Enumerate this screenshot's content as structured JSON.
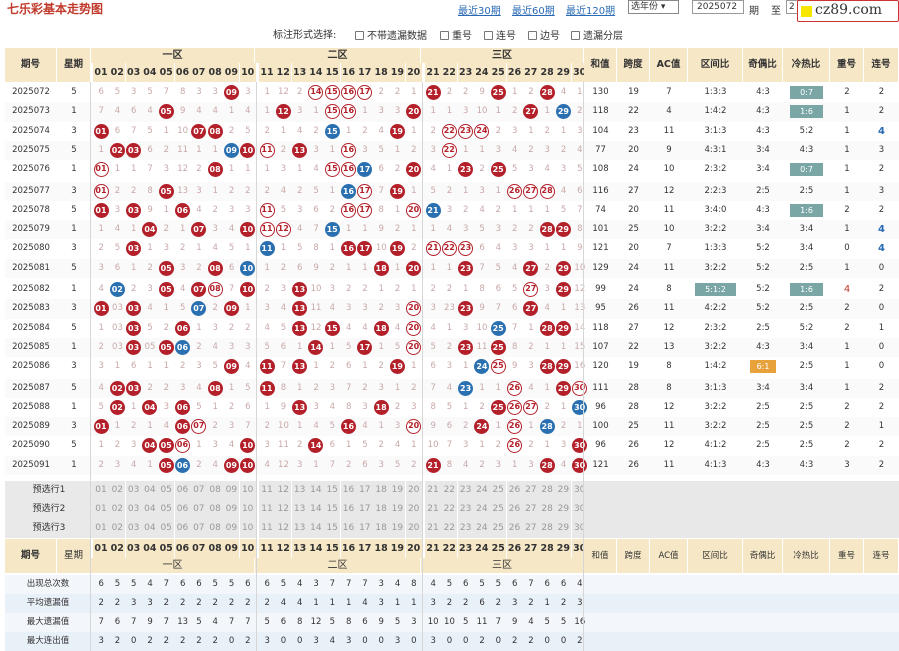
{
  "header": {
    "title": "七乐彩基本走势图",
    "links": [
      "最近30期",
      "最近60期",
      "最近120期"
    ],
    "year_select": "选年份",
    "from_issue": "2025072",
    "label_qi": "期",
    "label_to": "至",
    "to_issue": "2",
    "logo_text": "cz89.com"
  },
  "options": {
    "label": "标注形式选择:",
    "items": [
      "不带遗漏数据",
      "重号",
      "连号",
      "边号",
      "遗漏分层"
    ]
  },
  "columns": {
    "issue": "期号",
    "week": "星期",
    "zones": [
      "一区",
      "二区",
      "三区"
    ],
    "sum": "和值",
    "span": "跨度",
    "ac": "AC值",
    "zone_ratio": "区间比",
    "odd_even": "奇偶比",
    "hot_cold": "冷热比",
    "repeat": "重号",
    "consecutive": "连号"
  },
  "numbers": [
    "01",
    "02",
    "03",
    "04",
    "05",
    "06",
    "07",
    "08",
    "09",
    "10",
    "11",
    "12",
    "13",
    "14",
    "15",
    "16",
    "17",
    "18",
    "19",
    "20",
    "21",
    "22",
    "23",
    "24",
    "25",
    "26",
    "27",
    "28",
    "29",
    "30"
  ],
  "rows": [
    {
      "issue": "2025072",
      "week": "5",
      "cells": [
        "6",
        "5",
        "3",
        "5",
        "7",
        "8",
        "3",
        "3",
        "09b",
        "3",
        "1",
        "12",
        "2",
        "14",
        "15",
        "16",
        "17",
        "2",
        "2",
        "1",
        "21",
        "2",
        "2",
        "9",
        "25",
        "1",
        "2",
        "28",
        "4",
        "1"
      ],
      "marks": {
        "9": "red",
        "14": "redo",
        "15": "redo",
        "16": "redo",
        "17": "redo",
        "21": "red",
        "25": "red",
        "28": "red"
      },
      "sum": "130",
      "span": "19",
      "ac": "7",
      "zr": "1:3:3",
      "oe": "4:3",
      "hc": "0:7",
      "hcStyle": "teal",
      "rep": "2",
      "con": "2"
    },
    {
      "issue": "2025073",
      "week": "1",
      "cells": [
        "7",
        "4",
        "6",
        "4",
        "05",
        "9",
        "4",
        "4",
        "1",
        "4",
        "1",
        "12",
        "3",
        "1",
        "15",
        "16",
        "1",
        "3",
        "3",
        "20",
        "1",
        "1",
        "3",
        "10",
        "1",
        "2",
        "27",
        "1",
        "29",
        "2"
      ],
      "marks": {
        "5": "red",
        "12": "red",
        "15": "redo",
        "16": "redo",
        "20": "red",
        "27": "red",
        "29": "blue"
      },
      "sum": "118",
      "span": "22",
      "ac": "4",
      "zr": "1:4:2",
      "oe": "4:3",
      "hc": "1:6",
      "hcStyle": "teal",
      "rep": "1",
      "con": "2"
    },
    {
      "issue": "2025074",
      "week": "3",
      "cells": [
        "01",
        "6",
        "7",
        "5",
        "1",
        "10",
        "07",
        "08",
        "2",
        "5",
        "2",
        "1",
        "4",
        "2",
        "15",
        "1",
        "2",
        "4",
        "19",
        "1",
        "2",
        "22",
        "23",
        "24",
        "2",
        "3",
        "1",
        "2",
        "1",
        "3"
      ],
      "marks": {
        "1": "red",
        "7": "red",
        "8": "red",
        "15": "blue",
        "19": "red",
        "22": "redo",
        "23": "redo",
        "24": "redo"
      },
      "sum": "104",
      "span": "23",
      "ac": "11",
      "zr": "3:1:3",
      "oe": "4:3",
      "hc": "5:2",
      "rep": "1",
      "con": "4"
    },
    {
      "issue": "2025075",
      "week": "5",
      "cells": [
        "1",
        "02",
        "03",
        "6",
        "2",
        "11",
        "1",
        "1",
        "09",
        "10",
        "11",
        "2",
        "13",
        "3",
        "1",
        "16",
        "3",
        "5",
        "1",
        "2",
        "3",
        "22",
        "1",
        "1",
        "3",
        "4",
        "2",
        "3",
        "2",
        "4"
      ],
      "marks": {
        "2": "red",
        "3": "red",
        "9": "blue",
        "10": "red",
        "11": "redo",
        "13": "red",
        "16": "redo",
        "22": "redo"
      },
      "sum": "77",
      "span": "20",
      "ac": "9",
      "zr": "4:3:1",
      "oe": "3:4",
      "hc": "4:3",
      "rep": "1",
      "con": "3"
    },
    {
      "issue": "2025076",
      "week": "1",
      "cells": [
        "01",
        "1",
        "1",
        "7",
        "3",
        "12",
        "2",
        "08",
        "1",
        "1",
        "1",
        "3",
        "1",
        "4",
        "15",
        "16",
        "17",
        "6",
        "2",
        "20",
        "4",
        "1",
        "23",
        "2",
        "25",
        "5",
        "3",
        "4",
        "3",
        "5"
      ],
      "marks": {
        "1": "redo",
        "8": "red",
        "15": "redo",
        "16": "redo",
        "17": "blue",
        "20": "red",
        "23": "red",
        "25": "red"
      },
      "sum": "108",
      "span": "24",
      "ac": "10",
      "zr": "2:3:2",
      "oe": "3:4",
      "hc": "0:7",
      "hcStyle": "teal",
      "rep": "1",
      "con": "2"
    },
    {
      "issue": "2025077",
      "week": "3",
      "cells": [
        "01",
        "2",
        "2",
        "8",
        "05",
        "13",
        "3",
        "1",
        "2",
        "2",
        "2",
        "4",
        "2",
        "5",
        "1",
        "16",
        "17",
        "7",
        "18",
        "1",
        "5",
        "2",
        "1",
        "3",
        "1",
        "26",
        "27",
        "28",
        "4",
        "6"
      ],
      "marks": {
        "1": "redo",
        "5": "red",
        "16": "blue",
        "17": "redo",
        "19": "red",
        "26": "redo",
        "27": "redo",
        "28": "redo"
      },
      "sum": "116",
      "span": "27",
      "ac": "12",
      "zr": "2:2:3",
      "oe": "2:5",
      "hc": "2:5",
      "rep": "1",
      "con": "3"
    },
    {
      "issue": "2025078",
      "week": "5",
      "cells": [
        "01",
        "3",
        "03",
        "9",
        "1",
        "06",
        "4",
        "2",
        "3",
        "3",
        "11",
        "5",
        "3",
        "6",
        "2",
        "16",
        "17",
        "8",
        "1",
        "20",
        "21",
        "3",
        "2",
        "4",
        "2",
        "1",
        "1",
        "1",
        "5",
        "7"
      ],
      "marks": {
        "1": "red",
        "3": "red",
        "6": "red",
        "11": "redo",
        "16": "redo",
        "17": "redo",
        "20": "redo",
        "21": "blue"
      },
      "sum": "74",
      "span": "20",
      "ac": "11",
      "zr": "3:4:0",
      "oe": "4:3",
      "hc": "1:6",
      "hcStyle": "teal",
      "rep": "2",
      "con": "2"
    },
    {
      "issue": "2025079",
      "week": "1",
      "cells": [
        "1",
        "4",
        "1",
        "04",
        "2",
        "1",
        "07",
        "3",
        "4",
        "10",
        "11",
        "12",
        "4",
        "7",
        "15",
        "1",
        "1",
        "9",
        "2",
        "1",
        "1",
        "4",
        "3",
        "5",
        "3",
        "2",
        "2",
        "28",
        "29",
        "8"
      ],
      "marks": {
        "4": "red",
        "7": "red",
        "10": "red",
        "11": "redo",
        "12": "redo",
        "15": "blue",
        "28": "red",
        "29": "red"
      },
      "sum": "101",
      "span": "25",
      "ac": "10",
      "zr": "3:2:2",
      "oe": "3:4",
      "hc": "3:4",
      "rep": "1",
      "con": "4"
    },
    {
      "issue": "2025080",
      "week": "3",
      "cells": [
        "2",
        "5",
        "03",
        "1",
        "3",
        "2",
        "1",
        "4",
        "5",
        "1",
        "11",
        "1",
        "5",
        "8",
        "1",
        "16",
        "17",
        "10",
        "19",
        "2",
        "21",
        "22",
        "23",
        "6",
        "4",
        "3",
        "3",
        "1",
        "1",
        "9"
      ],
      "marks": {
        "3": "red",
        "11": "blue",
        "16": "red",
        "17": "red",
        "19": "red",
        "21": "redo",
        "22": "redo",
        "23": "redo"
      },
      "sum": "121",
      "span": "20",
      "ac": "7",
      "zr": "1:3:3",
      "oe": "5:2",
      "hc": "3:4",
      "rep": "0",
      "con": "4"
    },
    {
      "issue": "2025081",
      "week": "5",
      "cells": [
        "3",
        "6",
        "1",
        "2",
        "05",
        "3",
        "2",
        "06",
        "6",
        "10",
        "1",
        "2",
        "6",
        "9",
        "2",
        "1",
        "1",
        "18",
        "1",
        "20",
        "1",
        "1",
        "23",
        "7",
        "5",
        "4",
        "27",
        "2",
        "29",
        "10"
      ],
      "marks": {
        "5": "red",
        "8": "red",
        "10": "blue",
        "18": "red",
        "20": "red",
        "23": "red",
        "27": "red",
        "29": "red"
      },
      "sum": "129",
      "span": "24",
      "ac": "11",
      "zr": "3:2:2",
      "oe": "5:2",
      "hc": "2:5",
      "rep": "1",
      "con": "0"
    },
    {
      "issue": "2025082",
      "week": "1",
      "cells": [
        "4",
        "02",
        "2",
        "3",
        "05",
        "4",
        "07",
        "08",
        "7",
        "10",
        "2",
        "3",
        "13",
        "10",
        "3",
        "2",
        "2",
        "1",
        "2",
        "1",
        "2",
        "2",
        "1",
        "8",
        "6",
        "5",
        "27",
        "3",
        "29",
        "12"
      ],
      "marks": {
        "2": "blue",
        "5": "red",
        "7": "red",
        "8": "redo",
        "10": "red",
        "13": "red",
        "27": "redo",
        "29": "red"
      },
      "sum": "99",
      "span": "24",
      "ac": "8",
      "zr": "5:1:2",
      "zrStyle": "teal",
      "oe": "5:2",
      "hc": "1:6",
      "hcStyle": "teal",
      "rep": "4",
      "con": "2"
    },
    {
      "issue": "2025083",
      "week": "3",
      "cells": [
        "01",
        "03",
        "3",
        "4",
        "1",
        "5",
        "07",
        "2",
        "09",
        "1",
        "3",
        "4",
        "13",
        "11",
        "4",
        "3",
        "3",
        "2",
        "3",
        "20",
        "3",
        "23",
        "2",
        "9",
        "7",
        "6",
        "27",
        "4",
        "1",
        "13"
      ],
      "marks": {
        "1": "red",
        "3": "red",
        "7": "blue",
        "9": "red",
        "13": "red",
        "20": "redo",
        "23": "red",
        "27": "red"
      },
      "sum": "95",
      "span": "26",
      "ac": "11",
      "zr": "4:2:2",
      "oe": "5:2",
      "hc": "2:5",
      "rep": "2",
      "con": "0"
    },
    {
      "issue": "2025084",
      "week": "5",
      "cells": [
        "1",
        "03",
        "4",
        "5",
        "2",
        "06",
        "1",
        "3",
        "2",
        "2",
        "4",
        "5",
        "13",
        "12",
        "15",
        "4",
        "4",
        "18",
        "4",
        "20",
        "4",
        "1",
        "3",
        "10",
        "25",
        "7",
        "1",
        "28",
        "29",
        "14"
      ],
      "marks": {
        "3": "red",
        "6": "red",
        "13": "red",
        "15": "red",
        "18": "red",
        "20": "redo",
        "25": "blue",
        "28": "red",
        "29": "red"
      },
      "sum": "118",
      "span": "27",
      "ac": "12",
      "zr": "2:3:2",
      "oe": "2:5",
      "hc": "5:2",
      "rep": "2",
      "con": "1"
    },
    {
      "issue": "2025085",
      "week": "1",
      "cells": [
        "2",
        "03",
        "5",
        "05",
        "06",
        "1",
        "2",
        "4",
        "3",
        "3",
        "5",
        "6",
        "1",
        "14",
        "1",
        "5",
        "17",
        "1",
        "5",
        "20",
        "5",
        "2",
        "23",
        "11",
        "25",
        "8",
        "2",
        "1",
        "1",
        "15"
      ],
      "marks": {
        "3": "red",
        "5": "red",
        "6": "blue",
        "14": "red",
        "17": "red",
        "20": "redo",
        "23": "red",
        "25": "red"
      },
      "sum": "107",
      "span": "22",
      "ac": "13",
      "zr": "3:2:2",
      "oe": "4:3",
      "hc": "3:4",
      "rep": "1",
      "con": "0"
    },
    {
      "issue": "2025086",
      "week": "3",
      "cells": [
        "3",
        "1",
        "6",
        "1",
        "1",
        "2",
        "3",
        "5",
        "09",
        "4",
        "11",
        "7",
        "13",
        "1",
        "2",
        "6",
        "1",
        "2",
        "19",
        "1",
        "6",
        "3",
        "1",
        "24",
        "25",
        "9",
        "3",
        "28",
        "2",
        "16"
      ],
      "marks": {
        "9": "red",
        "11": "red",
        "13": "red",
        "19": "red",
        "24": "blue",
        "25": "redo",
        "28": "red",
        "29": "red"
      },
      "sum": "120",
      "span": "19",
      "ac": "8",
      "zr": "1:4:2",
      "oe": "6:1",
      "oeStyle": "orange",
      "hc": "2:5",
      "rep": "1",
      "con": "0"
    },
    {
      "issue": "2025087",
      "week": "5",
      "cells": [
        "4",
        "02",
        "03",
        "2",
        "2",
        "3",
        "4",
        "08",
        "1",
        "5",
        "11",
        "8",
        "1",
        "2",
        "3",
        "7",
        "2",
        "3",
        "1",
        "2",
        "7",
        "4",
        "23",
        "1",
        "1",
        "26",
        "4",
        "1",
        "29",
        "30"
      ],
      "marks": {
        "2": "red",
        "3": "red",
        "8": "red",
        "11": "red",
        "23": "blue",
        "26": "redo",
        "29": "red",
        "30": "redo"
      },
      "sum": "111",
      "span": "28",
      "ac": "8",
      "zr": "3:1:3",
      "oe": "3:4",
      "hc": "3:4",
      "rep": "1",
      "con": "2"
    },
    {
      "issue": "2025088",
      "week": "1",
      "cells": [
        "5",
        "02",
        "1",
        "04",
        "3",
        "06",
        "5",
        "1",
        "2",
        "6",
        "1",
        "9",
        "13",
        "3",
        "4",
        "8",
        "3",
        "18",
        "2",
        "3",
        "8",
        "5",
        "1",
        "2",
        "25",
        "26",
        "27",
        "2",
        "1",
        "30"
      ],
      "marks": {
        "2": "red",
        "4": "red",
        "6": "red",
        "13": "red",
        "18": "red",
        "25": "red",
        "26": "redo",
        "27": "redo",
        "30": "blue"
      },
      "sum": "96",
      "span": "28",
      "ac": "12",
      "zr": "3:2:2",
      "oe": "2:5",
      "hc": "2:5",
      "rep": "2",
      "con": "2"
    },
    {
      "issue": "2025089",
      "week": "3",
      "cells": [
        "01",
        "1",
        "2",
        "1",
        "4",
        "06",
        "07",
        "2",
        "3",
        "7",
        "2",
        "10",
        "1",
        "4",
        "5",
        "16",
        "4",
        "1",
        "3",
        "20",
        "9",
        "6",
        "2",
        "24",
        "1",
        "26",
        "1",
        "28",
        "2",
        "1"
      ],
      "marks": {
        "1": "red",
        "6": "red",
        "7": "redo",
        "16": "red",
        "20": "redo",
        "24": "red",
        "26": "redo",
        "28": "blue"
      },
      "sum": "100",
      "span": "25",
      "ac": "11",
      "zr": "3:2:2",
      "oe": "2:5",
      "hc": "2:5",
      "rep": "2",
      "con": "1"
    },
    {
      "issue": "2025090",
      "week": "5",
      "cells": [
        "1",
        "2",
        "3",
        "04",
        "05",
        "06",
        "1",
        "3",
        "4",
        "10",
        "3",
        "11",
        "2",
        "14",
        "6",
        "1",
        "5",
        "2",
        "4",
        "1",
        "10",
        "7",
        "3",
        "1",
        "2",
        "26",
        "2",
        "1",
        "3",
        "30"
      ],
      "marks": {
        "4": "red",
        "5": "red",
        "6": "redo",
        "10": "red",
        "14": "red",
        "26": "redo",
        "30": "red"
      },
      "sum": "96",
      "span": "26",
      "ac": "12",
      "zr": "4:1:2",
      "oe": "2:5",
      "hc": "2:5",
      "rep": "2",
      "con": "2"
    },
    {
      "issue": "2025091",
      "week": "1",
      "cells": [
        "2",
        "3",
        "4",
        "1",
        "05",
        "06",
        "2",
        "4",
        "09",
        "10",
        "4",
        "12",
        "3",
        "1",
        "7",
        "2",
        "6",
        "3",
        "5",
        "2",
        "21",
        "8",
        "4",
        "2",
        "3",
        "1",
        "3",
        "28",
        "4",
        "30"
      ],
      "marks": {
        "5": "red",
        "6": "blue",
        "9": "red",
        "10": "red",
        "21": "red",
        "28": "red",
        "30": "red"
      },
      "sum": "121",
      "span": "26",
      "ac": "11",
      "zr": "4:1:3",
      "oe": "4:3",
      "hc": "4:3",
      "rep": "3",
      "con": "2"
    }
  ],
  "predict_rows": [
    "预选行1",
    "预选行2",
    "预选行3"
  ],
  "stats": [
    {
      "label": "出现总次数",
      "values": [
        "6",
        "5",
        "5",
        "4",
        "7",
        "6",
        "6",
        "5",
        "5",
        "6",
        "6",
        "5",
        "4",
        "3",
        "7",
        "7",
        "7",
        "3",
        "4",
        "8",
        "4",
        "5",
        "6",
        "5",
        "5",
        "6",
        "7",
        "6",
        "6",
        "4"
      ]
    },
    {
      "label": "平均遗漏值",
      "values": [
        "2",
        "2",
        "3",
        "3",
        "2",
        "2",
        "2",
        "2",
        "2",
        "2",
        "2",
        "4",
        "4",
        "1",
        "1",
        "1",
        "4",
        "3",
        "1",
        "1",
        "3",
        "2",
        "2",
        "6",
        "2",
        "3",
        "2",
        "1",
        "2",
        "3"
      ]
    },
    {
      "label": "最大遗漏值",
      "values": [
        "7",
        "6",
        "7",
        "9",
        "7",
        "13",
        "5",
        "4",
        "7",
        "7",
        "5",
        "6",
        "8",
        "12",
        "5",
        "8",
        "6",
        "9",
        "5",
        "3",
        "10",
        "10",
        "5",
        "11",
        "7",
        "9",
        "4",
        "5",
        "5",
        "16"
      ]
    },
    {
      "label": "最大连出值",
      "values": [
        "3",
        "2",
        "0",
        "2",
        "2",
        "2",
        "2",
        "2",
        "0",
        "2",
        "3",
        "0",
        "0",
        "3",
        "4",
        "3",
        "0",
        "0",
        "3",
        "0",
        "3",
        "0",
        "0",
        "2",
        "0",
        "2",
        "2",
        "0",
        "0",
        "2"
      ]
    }
  ]
}
